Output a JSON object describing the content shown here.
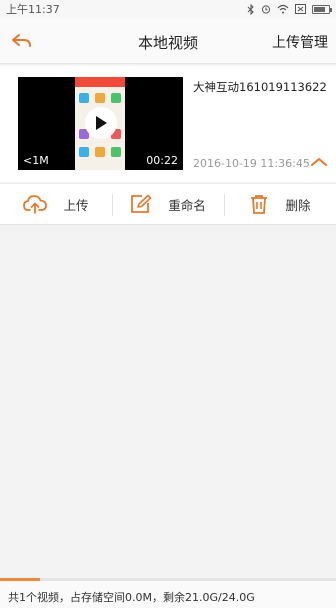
{
  "status_bar": {
    "time": "上午11:37"
  },
  "header": {
    "title": "本地视频",
    "upload_manage": "上传管理"
  },
  "video": {
    "name": "大神互动161019113622",
    "size": "<1M",
    "duration": "00:22",
    "date": "2016-10-19 11:36:45"
  },
  "actions": {
    "upload": "上传",
    "rename": "重命名",
    "delete": "删除"
  },
  "footer": {
    "summary": "共1个视频，占存储空间0.0M，剩余21.0G/24.0G",
    "storage_used_fraction": 0.12
  },
  "colors": {
    "accent": "#e8782a"
  }
}
